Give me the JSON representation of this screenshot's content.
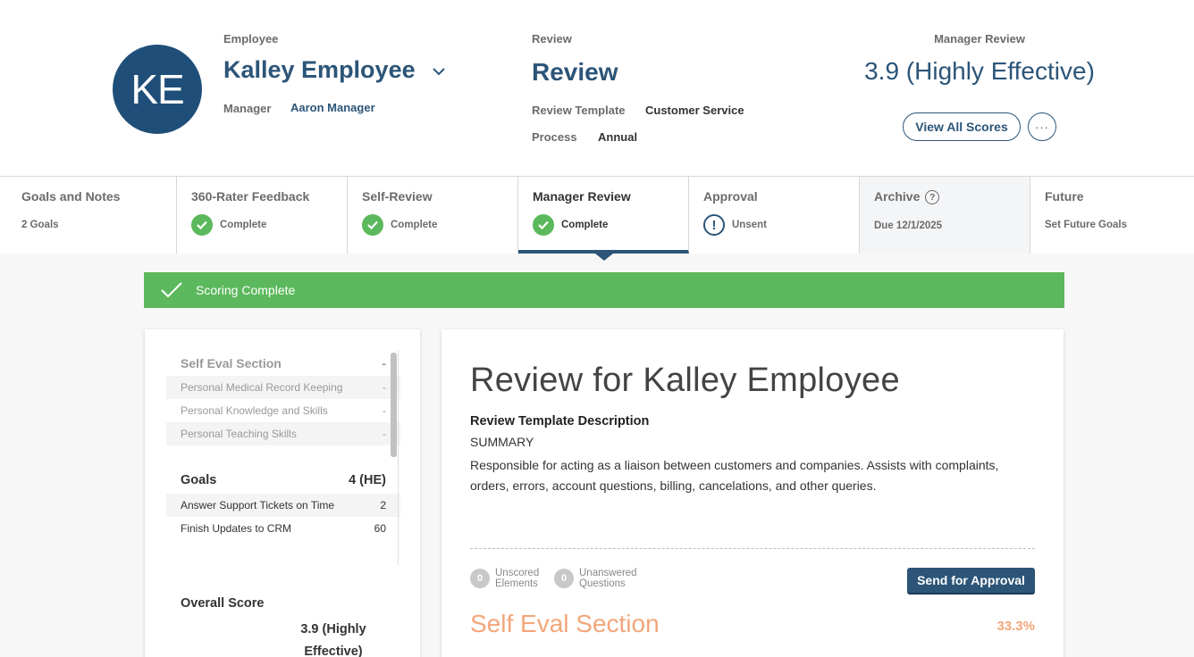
{
  "header": {
    "avatar_initials": "KE",
    "employee_label": "Employee",
    "employee_name": "Kalley Employee",
    "manager_label": "Manager",
    "manager_name": "Aaron Manager",
    "review_label": "Review",
    "review_title": "Review",
    "template_label": "Review Template",
    "template_value": "Customer Service",
    "process_label": "Process",
    "process_value": "Annual",
    "manager_review_label": "Manager Review",
    "manager_review_score": "3.9 (Highly Effective)",
    "view_all_scores": "View All Scores",
    "more_label": "···"
  },
  "tabs": [
    {
      "title": "Goals and Notes",
      "sub": "2 Goals"
    },
    {
      "title": "360-Rater Feedback",
      "sub": "Complete"
    },
    {
      "title": "Self-Review",
      "sub": "Complete"
    },
    {
      "title": "Manager Review",
      "sub": "Complete"
    },
    {
      "title": "Approval",
      "sub": "Unsent"
    },
    {
      "title": "Archive",
      "sub": "Due 12/1/2025"
    },
    {
      "title": "Future",
      "sub": "Set Future Goals"
    }
  ],
  "banner": {
    "text": "Scoring Complete"
  },
  "left_panel": {
    "section": {
      "label": "Self Eval Section",
      "score": "-"
    },
    "section_items": [
      {
        "label": "Personal Medical Record Keeping",
        "score": "-"
      },
      {
        "label": "Personal Knowledge and Skills",
        "score": "-"
      },
      {
        "label": "Personal Teaching Skills",
        "score": "-"
      }
    ],
    "goals": {
      "label": "Goals",
      "score": "4 (HE)"
    },
    "goal_items": [
      {
        "label": "Answer Support Tickets on Time",
        "score": "2"
      },
      {
        "label": "Finish Updates to CRM",
        "score": "60"
      }
    ],
    "overall_label": "Overall Score",
    "overall_value": "3.9 (Highly Effective)"
  },
  "main": {
    "title": "Review for Kalley Employee",
    "desc_heading": "Review Template Description",
    "desc_summary": "SUMMARY",
    "desc_body": "Responsible for acting as a liaison between customers and companies. Assists with complaints, orders, errors, account questions, billing, cancelations, and other queries.",
    "unscored": {
      "count": "0",
      "label1": "Unscored",
      "label2": "Elements"
    },
    "unanswered": {
      "count": "0",
      "label1": "Unanswered",
      "label2": "Questions"
    },
    "send_button": "Send for Approval",
    "section_title": "Self Eval Section",
    "section_pct": "33.3%"
  },
  "colors": {
    "brand": "#2c5578",
    "success": "#5cb85c",
    "accent_orange": "#f3a67a"
  }
}
